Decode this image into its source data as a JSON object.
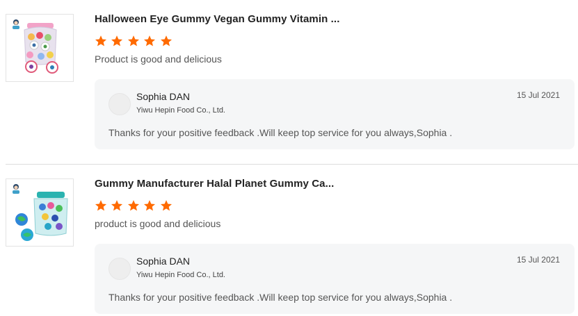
{
  "colors": {
    "star": "#ff6a00",
    "reply_bg": "#f5f6f7",
    "divider": "#dddddd"
  },
  "reviews": [
    {
      "product_title": "Halloween Eye Gummy Vegan Gummy Vitamin ...",
      "rating": 5,
      "rating_max": 5,
      "comment": "Product is good and delicious",
      "reply": {
        "seller_name": "Sophia DAN",
        "company": "Yiwu Hepin Food Co., Ltd.",
        "date": "15 Jul 2021",
        "text": "Thanks for your positive feedback .Will keep top service for you always,Sophia ."
      }
    },
    {
      "product_title": "Gummy Manufacturer Halal Planet Gummy Ca...",
      "rating": 5,
      "rating_max": 5,
      "comment": "product is good and delicious",
      "reply": {
        "seller_name": "Sophia DAN",
        "company": "Yiwu Hepin Food Co., Ltd.",
        "date": "15 Jul 2021",
        "text": "Thanks for your positive feedback .Will keep top service for you always,Sophia ."
      }
    }
  ]
}
